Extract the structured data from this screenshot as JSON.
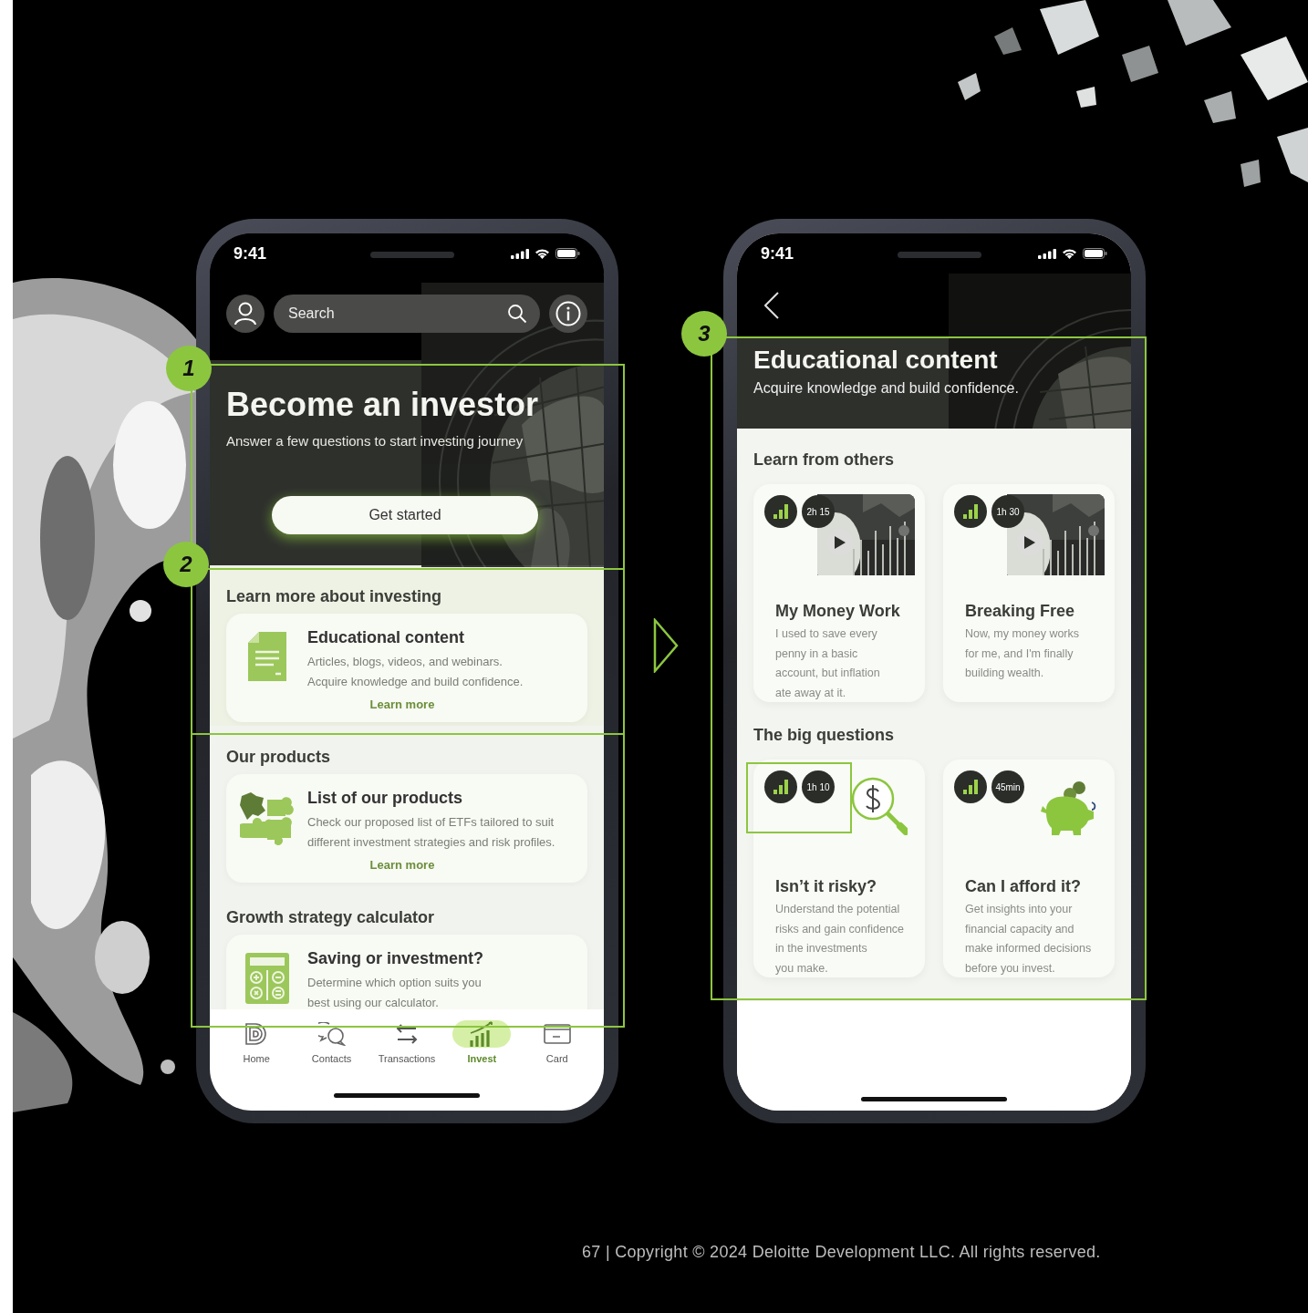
{
  "left_phone": {
    "time": "9:41",
    "search": {
      "placeholder": "Search"
    },
    "hero": {
      "title": "Become an investor",
      "subtitle": "Answer a few questions to start investing journey",
      "button": "Get started"
    },
    "sections": [
      {
        "heading": "Learn more about investing",
        "card": {
          "kind": "document",
          "title": "Educational content",
          "description": [
            "Articles, blogs, videos, and webinars.",
            "Acquire knowledge and build confidence."
          ],
          "link": "Learn more"
        }
      },
      {
        "heading": "Our products",
        "card": {
          "kind": "puzzle",
          "title": "List of our products",
          "description": [
            "Check our proposed list of ETFs tailored to suit",
            "different investment strategies and risk profiles."
          ],
          "link": "Learn more"
        }
      },
      {
        "heading": "Growth strategy calculator",
        "card": {
          "kind": "calculator",
          "title": "Saving or investment?",
          "description": [
            "Determine which option suits you",
            "best using our calculator."
          ]
        }
      }
    ],
    "nav": [
      {
        "kind": "home",
        "label": "Home",
        "selected": false
      },
      {
        "kind": "contacts",
        "label": "Contacts",
        "selected": false
      },
      {
        "kind": "transactions",
        "label": "Transactions",
        "selected": false
      },
      {
        "kind": "invest",
        "label": "Invest",
        "selected": true
      },
      {
        "kind": "card",
        "label": "Card",
        "selected": false
      }
    ]
  },
  "right_phone": {
    "time": "9:41",
    "header": {
      "title": "Educational content",
      "subtitle": "Acquire knowledge and build confidence."
    },
    "groups": [
      {
        "heading": "Learn from others",
        "cards": [
          {
            "kind": "video",
            "duration": "2h 15",
            "title": "My Money Work",
            "description": [
              "I used to save every",
              "penny in a basic",
              "account, but inflation",
              "ate away at it."
            ]
          },
          {
            "kind": "video",
            "duration": "1h 30",
            "title": "Breaking Free",
            "description": [
              "Now, my money works",
              "for me, and I'm finally",
              "building wealth."
            ]
          }
        ]
      },
      {
        "heading": "The big questions",
        "cards": [
          {
            "kind": "risk",
            "duration": "1h 10",
            "title": "Isn’t it risky?",
            "description": [
              "Understand the potential",
              "risks and gain confidence",
              "in the investments",
              "you make."
            ]
          },
          {
            "kind": "savings",
            "duration": "45min",
            "title": "Can I afford it?",
            "description": [
              "Get insights into your",
              "financial capacity and",
              "make informed decisions",
              "before you invest."
            ]
          }
        ]
      }
    ]
  },
  "annotations": [
    {
      "number": "1"
    },
    {
      "number": "2"
    },
    {
      "number": "3"
    }
  ],
  "footer": "67 | Copyright © 2024 Deloitte Development LLC. All rights reserved."
}
